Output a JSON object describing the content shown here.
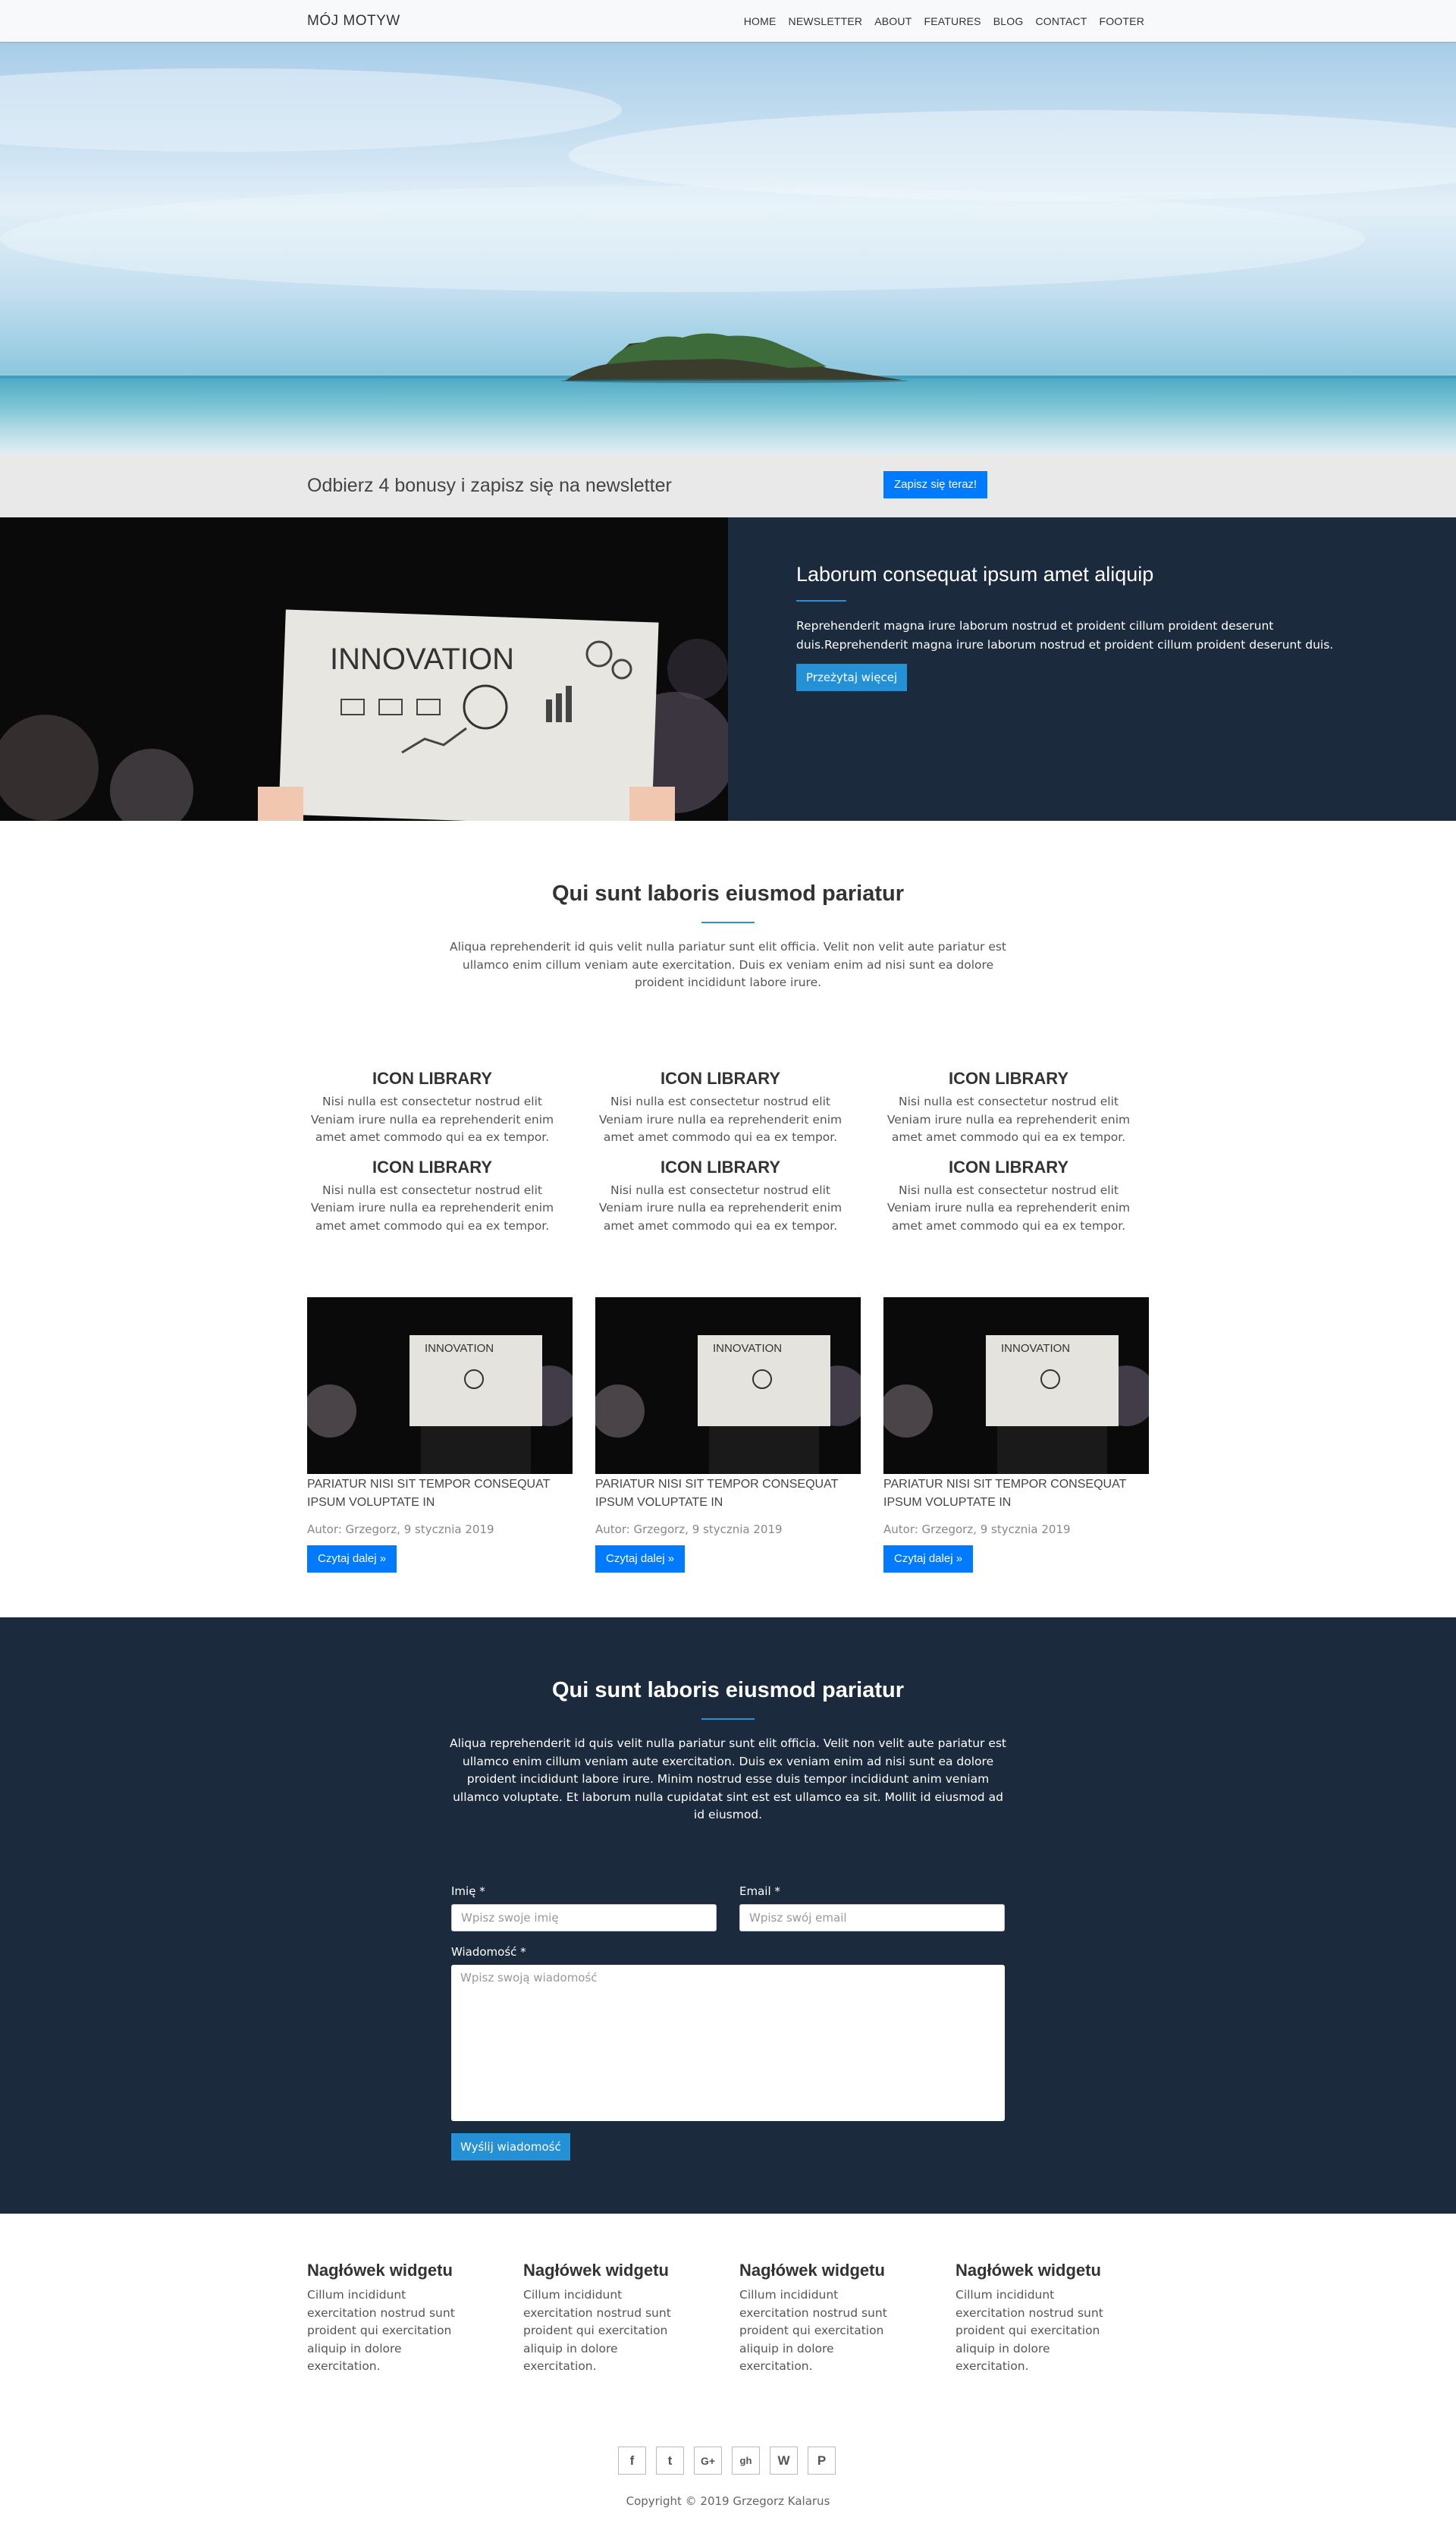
{
  "nav": {
    "brand": "MÓJ MOTYW",
    "items": [
      "HOME",
      "NEWSLETTER",
      "ABOUT",
      "FEATURES",
      "BLOG",
      "CONTACT",
      "FOOTER"
    ]
  },
  "newsletter": {
    "text": "Odbierz 4 bonusy i zapisz się na newsletter",
    "button": "Zapisz się teraz!"
  },
  "feature": {
    "title": "Laborum consequat ipsum amet aliquip",
    "body": "Reprehenderit magna irure laborum nostrud et proident cillum proident deserunt duis.Reprehenderit magna irure laborum nostrud et proident cillum proident deserunt duis.",
    "button": "Przeżytaj więcej",
    "image_word": "INNOVATION"
  },
  "services": {
    "title": "Qui sunt laboris eiusmod pariatur",
    "lead": "Aliqua reprehenderit id quis velit nulla pariatur sunt elit officia. Velit non velit aute pariatur est ullamco enim cillum veniam aute exercitation. Duis ex veniam enim ad nisi sunt ea dolore proident incididunt labore irure.",
    "items": [
      {
        "title": "ICON LIBRARY",
        "text": "Nisi nulla est consectetur nostrud elit Veniam irure nulla ea reprehenderit enim amet amet commodo qui ea ex tempor."
      },
      {
        "title": "ICON LIBRARY",
        "text": "Nisi nulla est consectetur nostrud elit Veniam irure nulla ea reprehenderit enim amet amet commodo qui ea ex tempor."
      },
      {
        "title": "ICON LIBRARY",
        "text": "Nisi nulla est consectetur nostrud elit Veniam irure nulla ea reprehenderit enim amet amet commodo qui ea ex tempor."
      },
      {
        "title": "ICON LIBRARY",
        "text": "Nisi nulla est consectetur nostrud elit Veniam irure nulla ea reprehenderit enim amet amet commodo qui ea ex tempor."
      },
      {
        "title": "ICON LIBRARY",
        "text": "Nisi nulla est consectetur nostrud elit Veniam irure nulla ea reprehenderit enim amet amet commodo qui ea ex tempor."
      },
      {
        "title": "ICON LIBRARY",
        "text": "Nisi nulla est consectetur nostrud elit Veniam irure nulla ea reprehenderit enim amet amet commodo qui ea ex tempor."
      }
    ]
  },
  "posts": [
    {
      "title": "PARIATUR NISI SIT TEMPOR CONSEQUAT IPSUM VOLUPTATE IN",
      "meta": "Autor: Grzegorz, 9 stycznia 2019",
      "button": "Czytaj dalej »"
    },
    {
      "title": "PARIATUR NISI SIT TEMPOR CONSEQUAT IPSUM VOLUPTATE IN",
      "meta": "Autor: Grzegorz, 9 stycznia 2019",
      "button": "Czytaj dalej »"
    },
    {
      "title": "PARIATUR NISI SIT TEMPOR CONSEQUAT IPSUM VOLUPTATE IN",
      "meta": "Autor: Grzegorz, 9 stycznia 2019",
      "button": "Czytaj dalej »"
    }
  ],
  "contact": {
    "title": "Qui sunt laboris eiusmod pariatur",
    "lead": "Aliqua reprehenderit id quis velit nulla pariatur sunt elit officia. Velit non velit aute pariatur est ullamco enim cillum veniam aute exercitation. Duis ex veniam enim ad nisi sunt ea dolore proident incididunt labore irure. Minim nostrud esse duis tempor incididunt anim veniam ullamco voluptate. Et laborum nulla cupidatat sint est est ullamco ea sit. Mollit id eiusmod ad id eiusmod.",
    "name_label": "Imię *",
    "name_placeholder": "Wpisz swoje imię",
    "email_label": "Email *",
    "email_placeholder": "Wpisz swój email",
    "message_label": "Wiadomość *",
    "message_placeholder": "Wpisz swoją wiadomość",
    "submit": "Wyślij wiadomość"
  },
  "footer": {
    "widgets": [
      {
        "title": "Nagłówek widgetu",
        "text": "Cillum incididunt exercitation nostrud sunt proident qui exercitation aliquip in dolore exercitation."
      },
      {
        "title": "Nagłówek widgetu",
        "text": "Cillum incididunt exercitation nostrud sunt proident qui exercitation aliquip in dolore exercitation."
      },
      {
        "title": "Nagłówek widgetu",
        "text": "Cillum incididunt exercitation nostrud sunt proident qui exercitation aliquip in dolore exercitation."
      },
      {
        "title": "Nagłówek widgetu",
        "text": "Cillum incididunt exercitation nostrud sunt proident qui exercitation aliquip in dolore exercitation."
      }
    ],
    "social": [
      {
        "icon": "facebook-icon",
        "glyph": "f"
      },
      {
        "icon": "twitter-icon",
        "glyph": "t"
      },
      {
        "icon": "google-plus-icon",
        "glyph": "G+"
      },
      {
        "icon": "github-icon",
        "glyph": "gh"
      },
      {
        "icon": "wordpress-icon",
        "glyph": "W"
      },
      {
        "icon": "pinterest-icon",
        "glyph": "P"
      }
    ],
    "copyright": "Copyright © 2019 Grzegorz Kalarus"
  },
  "colors": {
    "navy": "#1b2a3c",
    "primary": "#007bff",
    "accent": "#2490d6",
    "band": "#e9e9e9"
  }
}
